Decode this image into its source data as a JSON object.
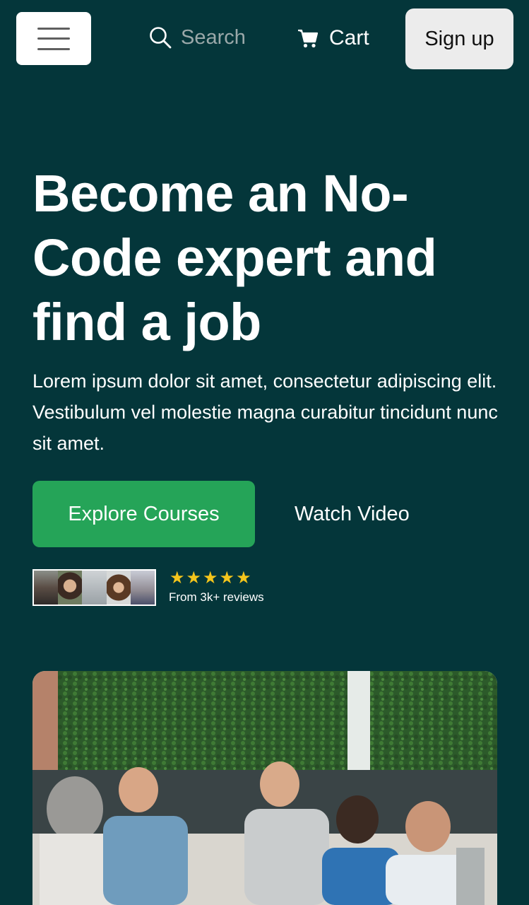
{
  "header": {
    "search_placeholder": "Search",
    "cart_label": "Cart",
    "signup_label": "Sign up",
    "icons": [
      "menu-icon",
      "search-icon",
      "cart-icon"
    ]
  },
  "hero": {
    "title": "Become an No-Code expert and find a job",
    "description": "Lorem ipsum dolor sit amet, consectetur adipiscing elit. Vestibulum vel molestie magna curabitur tincidunt nunc sit amet.",
    "primary_cta": "Explore Courses",
    "secondary_cta": "Watch Video"
  },
  "social_proof": {
    "rating": 5,
    "rating_max": 5,
    "reviews_text": "From 3k+ reviews"
  },
  "colors": {
    "background": "#04363a",
    "primary_button": "#25a458",
    "star": "#f4c51c",
    "signup_button": "#ececec"
  }
}
